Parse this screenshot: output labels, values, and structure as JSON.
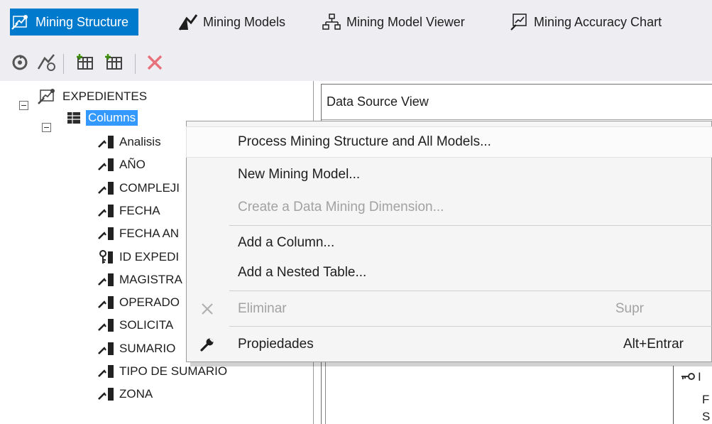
{
  "tabs": [
    {
      "label": "Mining Structure",
      "icon": "mining-structure-icon",
      "active": true
    },
    {
      "label": "Mining Models",
      "icon": "mining-models-icon",
      "active": false
    },
    {
      "label": "Mining Model Viewer",
      "icon": "mining-model-viewer-icon",
      "active": false
    },
    {
      "label": "Mining Accuracy Chart",
      "icon": "mining-accuracy-chart-icon",
      "active": false
    }
  ],
  "toolbar": {
    "buttons": [
      "process-icon",
      "process-model-icon",
      "add-column-icon",
      "add-nested-table-icon",
      "delete-icon"
    ]
  },
  "tree": {
    "root": "EXPEDIENTES",
    "columns_node": "Columns",
    "items": [
      {
        "label": "Analisis",
        "icon": "column-icon"
      },
      {
        "label": "AÑO",
        "icon": "column-icon"
      },
      {
        "label": "COMPLEJI",
        "icon": "column-icon"
      },
      {
        "label": "FECHA",
        "icon": "column-icon"
      },
      {
        "label": "FECHA AN",
        "icon": "column-icon"
      },
      {
        "label": "ID EXPEDI",
        "icon": "key-column-icon"
      },
      {
        "label": "MAGISTRA",
        "icon": "column-icon"
      },
      {
        "label": "OPERADO",
        "icon": "column-icon"
      },
      {
        "label": "SOLICITA",
        "icon": "column-icon"
      },
      {
        "label": "SUMARIO",
        "icon": "column-icon"
      },
      {
        "label": "TIPO DE SUMARIO",
        "icon": "column-icon"
      },
      {
        "label": "ZONA",
        "icon": "column-icon"
      }
    ]
  },
  "designer": {
    "header": "Data Source View",
    "table_fragments": [
      "I",
      "F",
      "S"
    ]
  },
  "context_menu": {
    "process_all": "Process Mining Structure and All Models...",
    "new_model": "New Mining Model...",
    "create_dimension": "Create a Data Mining Dimension...",
    "add_column": "Add a Column...",
    "add_nested": "Add a Nested Table...",
    "delete": "Eliminar",
    "delete_shortcut": "Supr",
    "properties": "Propiedades",
    "properties_shortcut": "Alt+Entrar"
  },
  "colors": {
    "accent": "#007acc",
    "selection": "#3399ff",
    "chrome": "#eeeef2"
  }
}
